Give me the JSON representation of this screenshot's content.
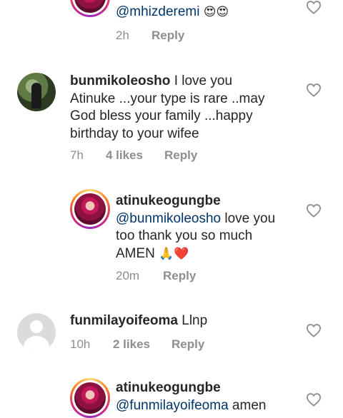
{
  "comments": [
    {
      "id": "c0",
      "avatar": "ring",
      "username": "",
      "mention": "@mhizderemi",
      "text": "",
      "emoji": "😍😍",
      "time": "2h",
      "likes": "",
      "reply_label": "Reply"
    },
    {
      "id": "c1",
      "avatar": "photo",
      "username": "bunmikoleosho",
      "lines": [
        "I love you",
        "Atinuke ...your type is rare ..may",
        "God bless your family ...happy",
        "birthday to your wifee"
      ],
      "time": "7h",
      "likes": "4 likes",
      "reply_label": "Reply"
    },
    {
      "id": "c2",
      "avatar": "ring",
      "username": "atinukeogungbe",
      "mention": "@bunmikoleosho",
      "text_after_mention": "love you",
      "line2": "too thank you so much",
      "line3": "AMEN",
      "emoji": "🙏❤️",
      "time": "20m",
      "likes": "",
      "reply_label": "Reply"
    },
    {
      "id": "c3",
      "avatar": "default",
      "username": "funmilayoifeoma",
      "text": "Llnp",
      "time": "10h",
      "likes": "2 likes",
      "reply_label": "Reply"
    },
    {
      "id": "c4",
      "avatar": "ring",
      "username": "atinukeogungbe",
      "mention": "@funmilayoifeoma",
      "text_after_mention": "amen"
    }
  ]
}
